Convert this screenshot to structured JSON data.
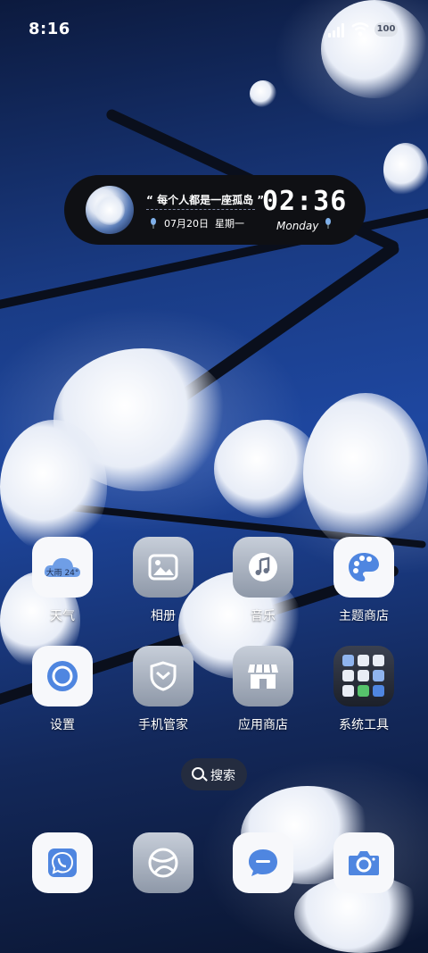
{
  "status_bar": {
    "time": "8:16",
    "battery_level": "100"
  },
  "widget": {
    "quote": "“ 每个人都是一座孤岛 ”",
    "date": "07月20日",
    "weekday_cn": "星期一",
    "clock": "02:36",
    "weekday_en": "Monday"
  },
  "apps": {
    "weather": {
      "label": "天气",
      "badge": "大雨 24°"
    },
    "gallery": {
      "label": "相册"
    },
    "music": {
      "label": "音乐"
    },
    "themes": {
      "label": "主题商店"
    },
    "settings": {
      "label": "设置"
    },
    "phone_manager": {
      "label": "手机管家"
    },
    "app_store": {
      "label": "应用商店"
    },
    "system_tools": {
      "label": "系统工具"
    }
  },
  "search": {
    "label": "搜索"
  },
  "dock": {
    "phone": "phone-icon",
    "browser": "browser-icon",
    "messages": "message-icon",
    "camera": "camera-icon"
  },
  "colors": {
    "accent_blue": "#4f86e0",
    "tile_white": "#f7f8fb"
  }
}
